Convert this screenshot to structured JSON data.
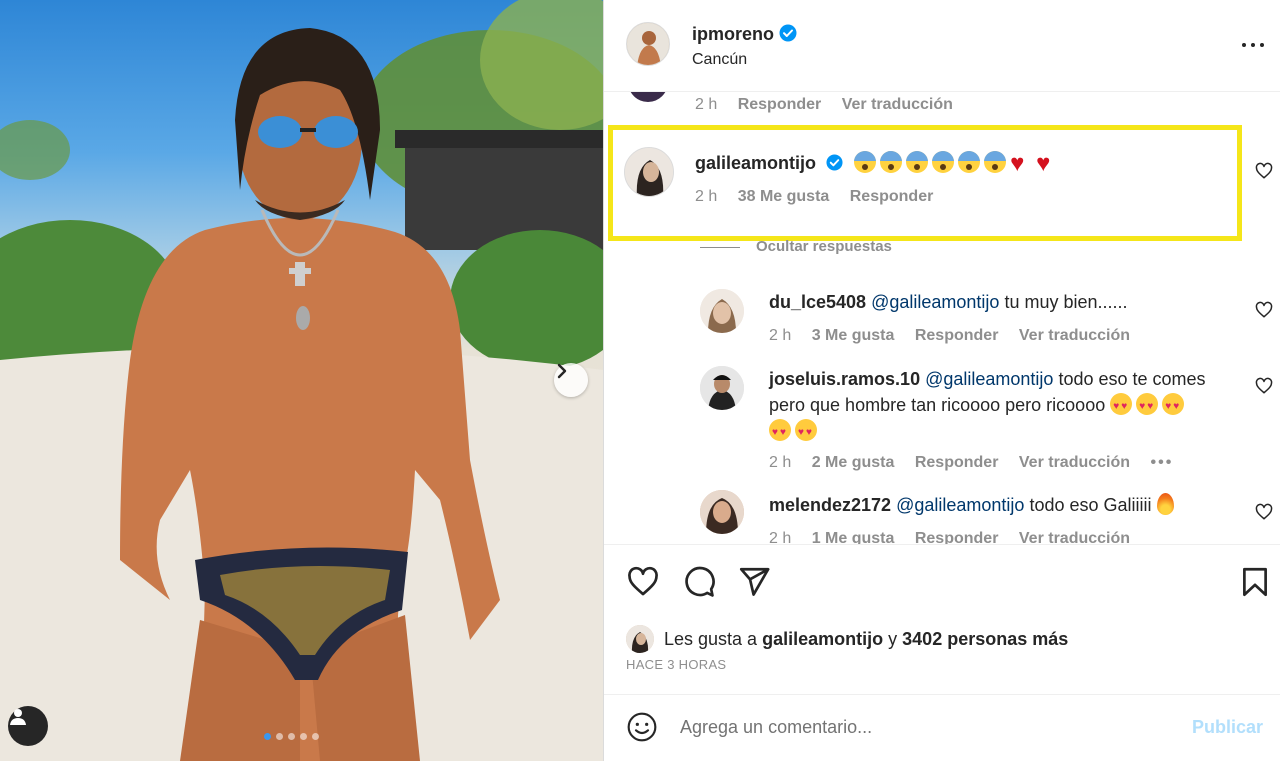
{
  "post": {
    "owner": {
      "username": "ipmoreno",
      "verified": true,
      "location": "Cancún"
    },
    "carousel": {
      "slide_count": 5,
      "active_slide": 1
    }
  },
  "comments": [
    {
      "username": "",
      "text": "",
      "time": "2 h",
      "likes": "",
      "reply_label": "Responder",
      "translate_label": "Ver traducción"
    },
    {
      "username": "galileamontijo",
      "verified": true,
      "emojis": [
        "fearful",
        "fearful",
        "fearful",
        "fearful",
        "fearful",
        "fearful",
        "red-heart",
        "red-heart"
      ],
      "time": "2 h",
      "likes": "38 Me gusta",
      "reply_label": "Responder",
      "highlighted": true
    }
  ],
  "hide_replies_label": "Ocultar respuestas",
  "replies": [
    {
      "username": "du_lce5408",
      "mention": "@galileamontijo",
      "text": "tu muy bien......",
      "time": "2 h",
      "likes": "3 Me gusta",
      "reply_label": "Responder",
      "translate_label": "Ver traducción"
    },
    {
      "username": "joseluis.ramos.10",
      "mention": "@galileamontijo",
      "text_line1": "todo eso te comes",
      "text_line2": "pero que hombre tan ricoooo pero ricoooo",
      "emojis": [
        "heart-eyes",
        "heart-eyes",
        "heart-eyes",
        "heart-eyes",
        "heart-eyes"
      ],
      "time": "2 h",
      "likes": "2 Me gusta",
      "reply_label": "Responder",
      "translate_label": "Ver traducción"
    },
    {
      "username": "melendez2172",
      "mention": "@galileamontijo",
      "text": "todo eso Galiiiii",
      "emojis": [
        "fire"
      ],
      "time": "2 h",
      "likes": "1 Me gusta",
      "reply_label": "Responder",
      "translate_label": "Ver traducción"
    }
  ],
  "likes": {
    "prefix": "Les gusta a",
    "user": "galileamontijo",
    "connector": "y",
    "others": "3402 personas más"
  },
  "timestamp": "HACE 3 HORAS",
  "add_comment": {
    "placeholder": "Agrega un comentario...",
    "publish_label": "Publicar"
  },
  "icons": {
    "like": "heart-outline-icon",
    "comment": "comment-bubble-icon",
    "share": "paper-plane-icon",
    "save": "bookmark-icon",
    "emoji": "smiley-icon",
    "more": "more-horizontal-icon",
    "next": "chevron-right-icon"
  },
  "colors": {
    "highlight_box": "#f5e619",
    "verified": "#0095f6",
    "mention": "#00376b",
    "publish_disabled": "#b2dffc"
  }
}
